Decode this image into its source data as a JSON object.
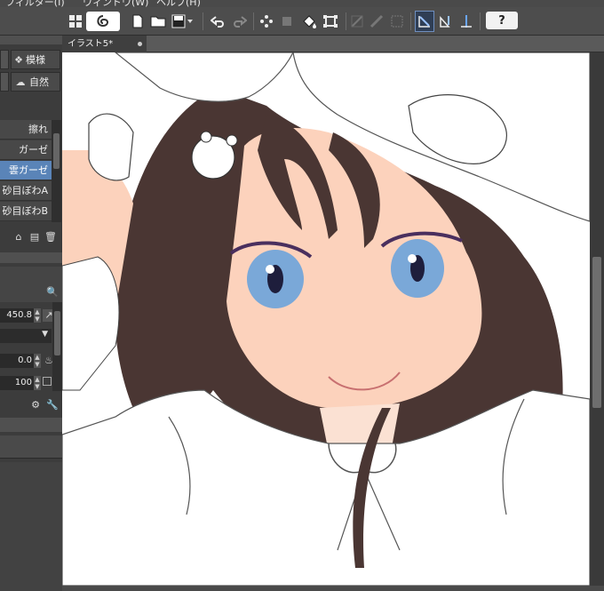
{
  "menu": {
    "items": [
      "フィルター(I)",
      "ウィンドウ(W)",
      "ヘルプ(H)"
    ]
  },
  "toolbar": {
    "help_label": "?",
    "icons": [
      "layout-icon",
      "clip-logo-icon",
      "new-icon",
      "open-icon",
      "save-icon",
      "undo-icon",
      "redo-icon",
      "clear-icon",
      "fill-icon",
      "transform-icon",
      "snap-icon",
      "ruler-icon",
      "symmetry-icon"
    ]
  },
  "document": {
    "tab_title": "イラスト5*"
  },
  "left_panel": {
    "top_buttons": [
      {
        "label": "模様",
        "icon": "pattern-icon"
      },
      {
        "label": "自然",
        "icon": "nature-icon"
      }
    ],
    "brushes": [
      "擦れ",
      "ガーゼ",
      "雲ガーゼ",
      "砂目ぼわA",
      "砂目ぼわB"
    ],
    "selected_brush": "雲ガーゼ",
    "brush_size": "450.8",
    "opacity_value": "0.0",
    "density_value": "100"
  },
  "colors": {
    "panel_bg": "#3c3c3c",
    "selected": "#5a84b8",
    "canvas": "#ffffff",
    "hair": "#4a3633",
    "skin": "#fcd2bc",
    "eye": "#7aa8d8",
    "eyeliner": "#4a2f5e"
  }
}
